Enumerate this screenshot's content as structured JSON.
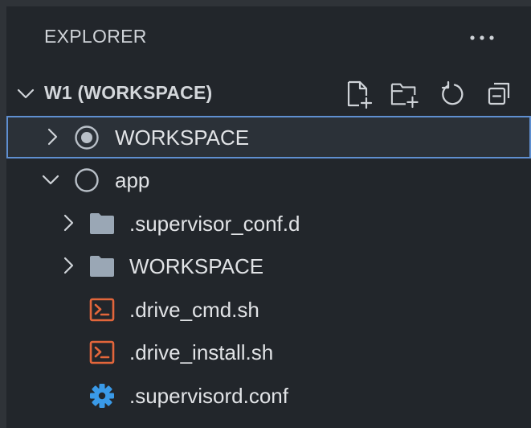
{
  "explorer": {
    "title": "EXPLORER",
    "more_actions_icon": "ellipsis-icon"
  },
  "workspace": {
    "title": "W1 (WORKSPACE)",
    "actions": [
      {
        "name": "new-file-button",
        "icon": "new-file-icon"
      },
      {
        "name": "new-folder-button",
        "icon": "new-folder-icon"
      },
      {
        "name": "refresh-button",
        "icon": "refresh-icon"
      },
      {
        "name": "collapse-all-button",
        "icon": "collapse-all-icon"
      }
    ]
  },
  "tree": {
    "items": [
      {
        "label": "WORKSPACE",
        "kind": "root-folder",
        "expanded": false,
        "selected": true,
        "icon": "radio-filled-icon"
      },
      {
        "label": "app",
        "kind": "root-folder",
        "expanded": true,
        "selected": false,
        "icon": "radio-empty-icon"
      },
      {
        "label": ".supervisor_conf.d",
        "kind": "folder",
        "expanded": false,
        "icon": "folder-icon"
      },
      {
        "label": "WORKSPACE",
        "kind": "folder",
        "expanded": false,
        "icon": "folder-icon"
      },
      {
        "label": ".drive_cmd.sh",
        "kind": "file",
        "icon": "shell-script-icon"
      },
      {
        "label": ".drive_install.sh",
        "kind": "file",
        "icon": "shell-script-icon"
      },
      {
        "label": ".supervisord.conf",
        "kind": "file",
        "icon": "gear-icon"
      }
    ]
  },
  "colors": {
    "panel_bg": "#22262b",
    "selection_border": "#5f8fd0",
    "shell_icon": "#e3663b",
    "gear_icon": "#3a9ae8",
    "folder_icon": "#9aa7b5"
  }
}
